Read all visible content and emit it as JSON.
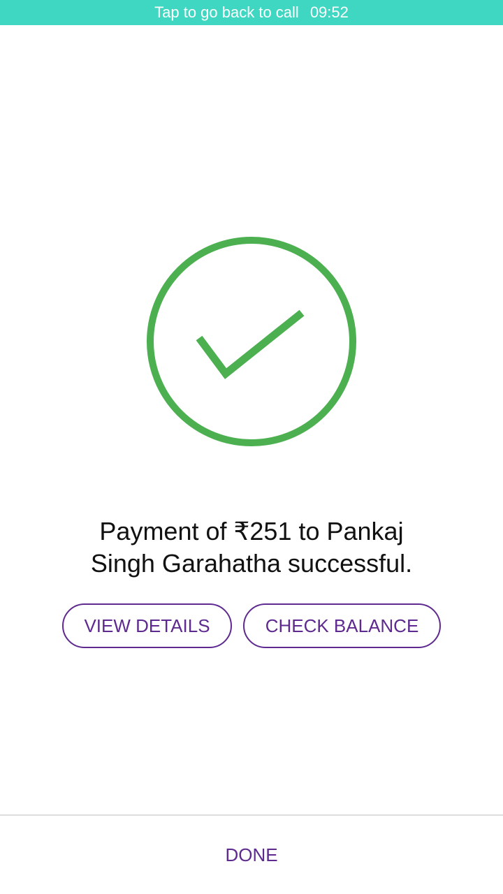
{
  "call_bar": {
    "text": "Tap to go back to call",
    "time": "09:52",
    "color": "#3fd6c2"
  },
  "status": {
    "icon": "check-circle-icon",
    "color": "#4caf50"
  },
  "message": {
    "line1": "Payment of ₹251 to Pankaj",
    "line2": "Singh Garahatha successful."
  },
  "actions": {
    "view_details": "VIEW DETAILS",
    "check_balance": "CHECK BALANCE",
    "accent": "#5e2a8f"
  },
  "footer": {
    "done": "DONE"
  }
}
